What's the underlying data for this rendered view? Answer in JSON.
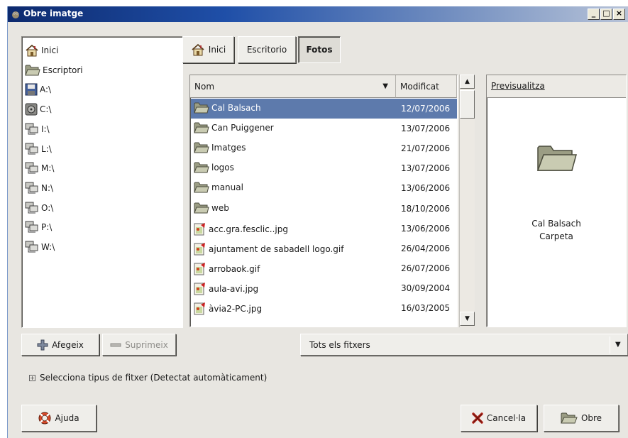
{
  "window": {
    "title": "Obre imatge"
  },
  "places": [
    {
      "label": "Inici",
      "icon": "home-icon"
    },
    {
      "label": "Escriptori",
      "icon": "folder-icon"
    },
    {
      "label": "A:\\",
      "icon": "floppy-icon"
    },
    {
      "label": "C:\\",
      "icon": "harddisk-icon"
    },
    {
      "label": "I:\\",
      "icon": "network-drive-icon"
    },
    {
      "label": "L:\\",
      "icon": "network-drive-icon"
    },
    {
      "label": "M:\\",
      "icon": "network-drive-icon"
    },
    {
      "label": "N:\\",
      "icon": "network-drive-icon"
    },
    {
      "label": "O:\\",
      "icon": "network-drive-icon"
    },
    {
      "label": "P:\\",
      "icon": "network-drive-icon"
    },
    {
      "label": "W:\\",
      "icon": "network-drive-icon"
    }
  ],
  "path_bar": [
    {
      "label": "Inici",
      "icon": "home-icon"
    },
    {
      "label": "Escritorio"
    },
    {
      "label": "Fotos",
      "active": true
    }
  ],
  "file_list": {
    "columns": {
      "name": "Nom",
      "modified": "Modificat"
    },
    "rows": [
      {
        "name": "Cal Balsach",
        "date": "12/07/2006",
        "type": "folder",
        "selected": true
      },
      {
        "name": "Can Puiggener",
        "date": "13/07/2006",
        "type": "folder"
      },
      {
        "name": "Imatges",
        "date": "21/07/2006",
        "type": "folder"
      },
      {
        "name": "logos",
        "date": "13/07/2006",
        "type": "folder"
      },
      {
        "name": "manual",
        "date": "13/06/2006",
        "type": "folder"
      },
      {
        "name": "web",
        "date": "18/10/2006",
        "type": "folder"
      },
      {
        "name": "acc.gra.fesclic..jpg",
        "date": "13/06/2006",
        "type": "image"
      },
      {
        "name": "ajuntament de sabadell logo.gif",
        "date": "26/04/2006",
        "type": "image"
      },
      {
        "name": "arrobaok.gif",
        "date": "26/07/2006",
        "type": "image"
      },
      {
        "name": "aula-avi.jpg",
        "date": "30/09/2004",
        "type": "image"
      },
      {
        "name": "àvia2-PC.jpg",
        "date": "16/03/2005",
        "type": "image"
      }
    ]
  },
  "preview": {
    "header": "Previsualitza",
    "name": "Cal Balsach",
    "kind": "Carpeta"
  },
  "buttons": {
    "add": "Afegeix",
    "remove": "Suprimeix",
    "help": "Ajuda",
    "cancel": "Cancel·la",
    "open": "Obre"
  },
  "filter": {
    "selected": "Tots els fitxers"
  },
  "expander": {
    "label": "Selecciona tipus de fitxer (Detectat automàticament)"
  },
  "colors": {
    "selection": "#5d7aac",
    "title_start": "#0d2a6e",
    "title_end": "#b7c3d8"
  }
}
